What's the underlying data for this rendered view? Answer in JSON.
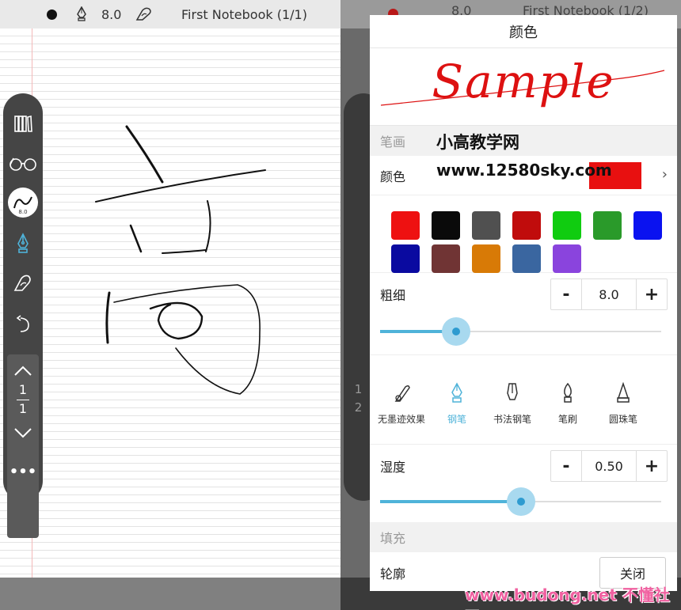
{
  "left_screen": {
    "topbar": {
      "pen_size": "8.0",
      "notebook_title": "First Notebook (1/1)"
    },
    "page_nav": {
      "current": "1",
      "total": "1"
    },
    "pen_button_size": "8.0",
    "more_label": "•••"
  },
  "right_screen": {
    "topbar": {
      "pen_size": "8.0",
      "notebook_title": "First Notebook (1/2)"
    },
    "page_nav": {
      "current": "1",
      "total": "2"
    }
  },
  "dialog": {
    "title": "颜色",
    "sample_text": "Sample",
    "stroke_section": "笔画",
    "color_label": "颜色",
    "current_color": "#e81010",
    "palette": [
      "#ee1111",
      "#0a0a0a",
      "#505050",
      "#c00c0c",
      "#10cc10",
      "#2a9a2a",
      "#0a12f0",
      "#0a0aa0",
      "#703434",
      "#d87a06",
      "#3a66a0",
      "#8a44dd"
    ],
    "thickness": {
      "label": "粗细",
      "value": "8.0",
      "minus": "-",
      "plus": "+",
      "fraction": 0.27
    },
    "pen_types": [
      {
        "label": "无墨迹效果",
        "icon": "feather-pen-icon",
        "active": false
      },
      {
        "label": "钢笔",
        "icon": "fountain-pen-icon",
        "active": true
      },
      {
        "label": "书法钢笔",
        "icon": "calligraphy-pen-icon",
        "active": false
      },
      {
        "label": "笔刷",
        "icon": "brush-icon",
        "active": false
      },
      {
        "label": "圆珠笔",
        "icon": "ballpoint-pen-icon",
        "active": false
      }
    ],
    "wetness": {
      "label": "湿度",
      "value": "0.50",
      "minus": "-",
      "plus": "+",
      "fraction": 0.5
    },
    "fill_section": "填充",
    "outline_label": "轮廓",
    "outline_value": "关闭"
  },
  "watermarks": {
    "site_name": "小高教学网",
    "site_url": "www.12580sky.com",
    "footer": "www.budong.net 不懂社区"
  }
}
